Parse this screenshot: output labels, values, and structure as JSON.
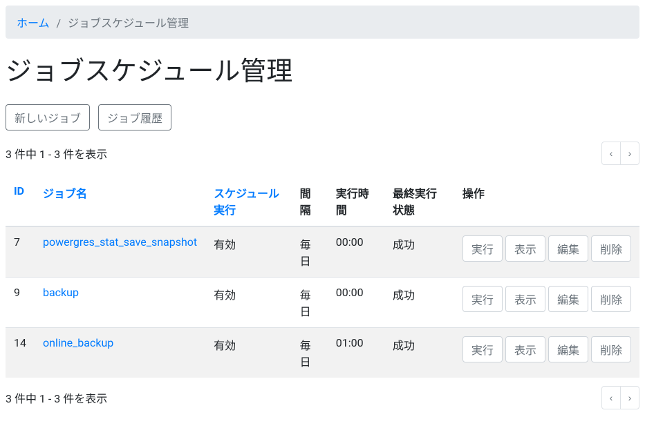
{
  "breadcrumb": {
    "home": "ホーム",
    "separator": "/",
    "current": "ジョブスケジュール管理"
  },
  "title": "ジョブスケジュール管理",
  "toolbar": {
    "new_job": "新しいジョブ",
    "job_history": "ジョブ履歴"
  },
  "summary": "3 件中 1 - 3 件を表示",
  "pager": {
    "prev": "‹",
    "next": "›"
  },
  "table": {
    "headers": {
      "id": "ID",
      "job_name": "ジョブ名",
      "schedule_exec": "スケジュール実行",
      "interval": "間隔",
      "exec_time": "実行時間",
      "last_status": "最終実行状態",
      "actions": "操作"
    },
    "action_labels": {
      "run": "実行",
      "show": "表示",
      "edit": "編集",
      "delete": "削除"
    },
    "rows": [
      {
        "id": "7",
        "job_name": "powergres_stat_save_snapshot",
        "schedule_exec": "有効",
        "interval": "毎日",
        "exec_time": "00:00",
        "last_status": "成功"
      },
      {
        "id": "9",
        "job_name": "backup",
        "schedule_exec": "有効",
        "interval": "毎日",
        "exec_time": "00:00",
        "last_status": "成功"
      },
      {
        "id": "14",
        "job_name": "online_backup",
        "schedule_exec": "有効",
        "interval": "毎日",
        "exec_time": "01:00",
        "last_status": "成功"
      }
    ]
  }
}
